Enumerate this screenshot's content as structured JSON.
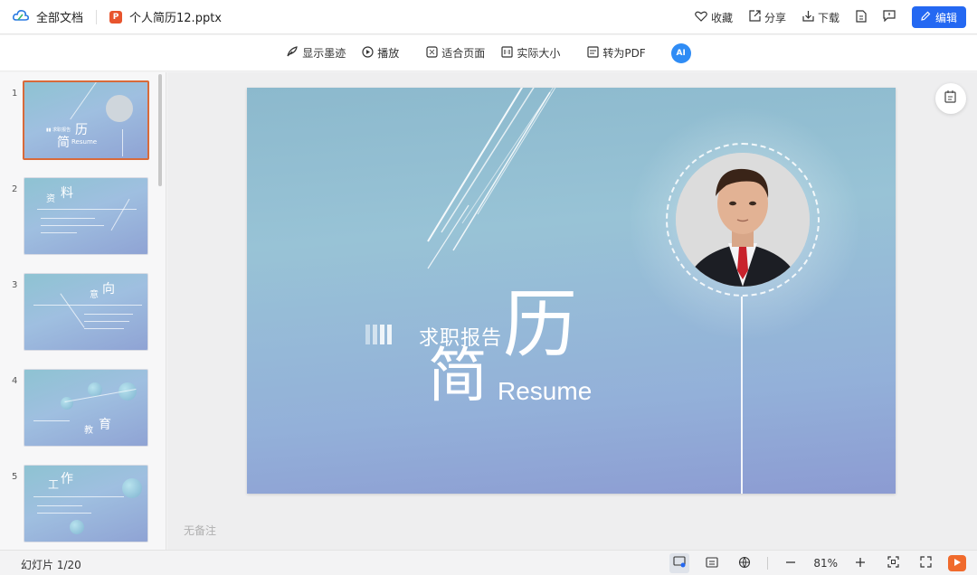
{
  "topbar": {
    "all_docs": "全部文档",
    "file_name": "个人简历12.pptx",
    "file_badge": "P",
    "favorite": "收藏",
    "share": "分享",
    "download": "下载",
    "edit": "编辑"
  },
  "toolbar": {
    "show_ink": "显示墨迹",
    "play": "播放",
    "fit_page": "适合页面",
    "actual_size": "实际大小",
    "to_pdf": "转为PDF",
    "ai": "AI"
  },
  "thumbnails": [
    {
      "num": "1",
      "t1": "简",
      "t2": "历",
      "t3": "Resume",
      "active": true
    },
    {
      "num": "2",
      "t1": "资",
      "t2": "料"
    },
    {
      "num": "3",
      "t1": "意",
      "t2": "向"
    },
    {
      "num": "4",
      "t1": "教",
      "t2": "育"
    },
    {
      "num": "5",
      "t1": "工",
      "t2": "作"
    }
  ],
  "slide": {
    "subtitle": "求职报告",
    "big1": "历",
    "big2": "简",
    "resume": "Resume"
  },
  "notes": "无备注",
  "status": {
    "slide_counter": "幻灯片 1/20",
    "zoom": "81%"
  },
  "colors": {
    "accent": "#2468f2",
    "active_border": "#d86a3a",
    "play": "#f06a2c"
  }
}
